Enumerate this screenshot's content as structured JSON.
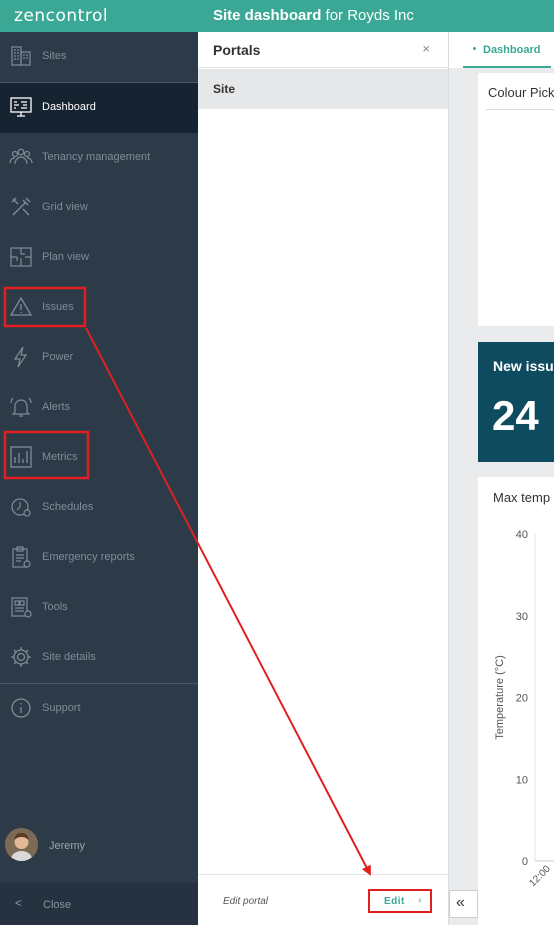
{
  "app": {
    "logo": "zencontrol",
    "title_bold": "Site dashboard",
    "title_rest": " for Royds Inc"
  },
  "sidebar": {
    "items": [
      {
        "label": "Sites",
        "icon": "building-icon"
      },
      {
        "label": "Dashboard",
        "icon": "dashboard-monitor-icon"
      },
      {
        "label": "Tenancy management",
        "icon": "people-icon"
      },
      {
        "label": "Grid view",
        "icon": "tools-icon"
      },
      {
        "label": "Plan view",
        "icon": "floor-plan-icon"
      },
      {
        "label": "Issues",
        "icon": "warning-icon"
      },
      {
        "label": "Power",
        "icon": "lightning-icon"
      },
      {
        "label": "Alerts",
        "icon": "bell-icon"
      },
      {
        "label": "Metrics",
        "icon": "bar-chart-icon"
      },
      {
        "label": "Schedules",
        "icon": "clock-icon"
      },
      {
        "label": "Emergency reports",
        "icon": "clipboard-icon"
      },
      {
        "label": "Tools",
        "icon": "tools-panel-icon"
      },
      {
        "label": "Site details",
        "icon": "gear-icon"
      },
      {
        "label": "Support",
        "icon": "info-icon"
      }
    ],
    "active": "Dashboard",
    "user_name": "Jeremy",
    "close_label": "Close"
  },
  "portals": {
    "title": "Portals",
    "close_symbol": "×",
    "site_label": "Site",
    "edit_portal_label": "Edit portal",
    "edit_label": "Edit",
    "edit_chevron": "›"
  },
  "main": {
    "tab_label": "Dashboard",
    "card1_title": "Colour Pick",
    "card2_title": "New issu",
    "card2_value": "24",
    "card3_title": "Max temp",
    "collapse_symbol": "«"
  },
  "chart_data": {
    "type": "line",
    "title": "Max temp",
    "ylabel": "Temperature (°C)",
    "yticks": [
      "40",
      "30",
      "20",
      "10",
      "0"
    ],
    "ylim": [
      0,
      40
    ],
    "xticks": [
      "12:00"
    ],
    "grid": true
  },
  "colors": {
    "accent": "#3aa894",
    "sidebar_bg": "#2d3a48",
    "active_bg": "#162330",
    "issues_card_bg": "#0f4b5f",
    "highlight": "#e02020"
  }
}
